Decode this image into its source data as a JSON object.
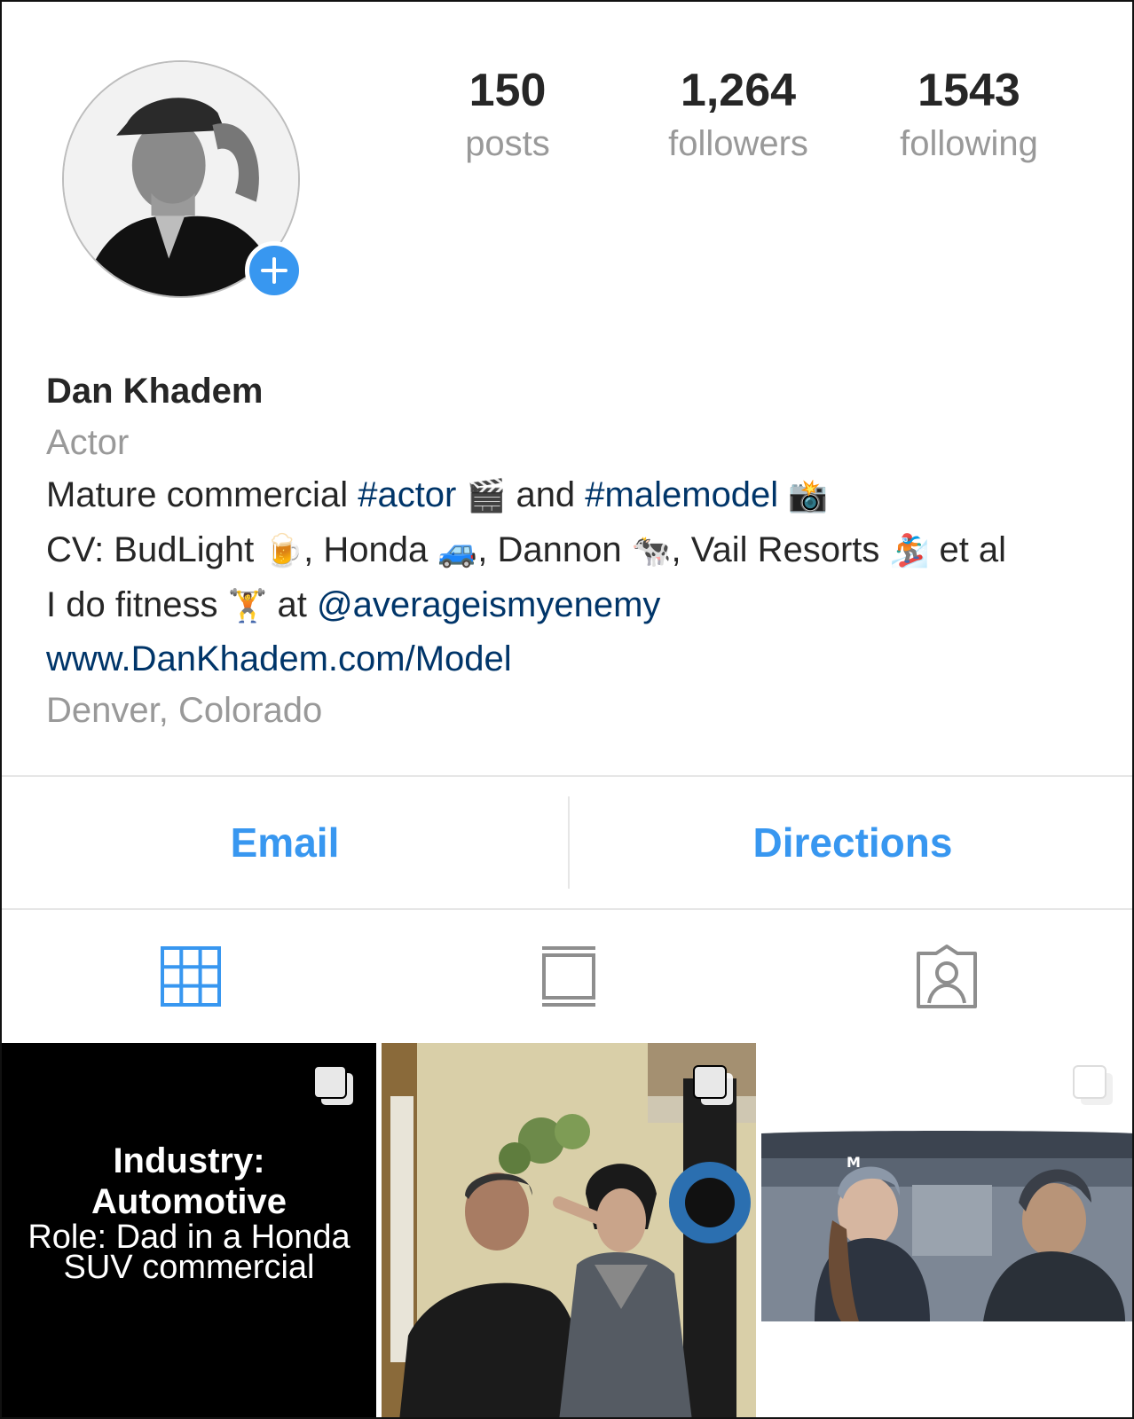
{
  "profile": {
    "stats": [
      {
        "count": "150",
        "label": "posts"
      },
      {
        "count": "1,264",
        "label": "followers"
      },
      {
        "count": "1543",
        "label": "following"
      }
    ],
    "name": "Dan Khadem",
    "category": "Actor",
    "bio": {
      "line1": {
        "a": "Mature commercial ",
        "tag1": "#actor",
        "e1": "🎬",
        "b": " and ",
        "tag2": "#malemodel",
        "e2": "📸"
      },
      "line2": {
        "a": "CV: BudLight ",
        "e1": "🍺",
        "b": ", Honda ",
        "e2": "🚙",
        "c": ", Dannon ",
        "e3": "🐄",
        "d": ", Vail Resorts ",
        "e4": "🏂",
        "e": " et al"
      },
      "line3": {
        "a": "I do fitness ",
        "e1": "🏋",
        "b": " at ",
        "mention": "@averageismyenemy"
      }
    },
    "website": "www.DanKhadem.com/Model",
    "location": "Denver, Colorado"
  },
  "actions": {
    "email": "Email",
    "directions": "Directions"
  },
  "tabs": [
    {
      "icon": "grid-icon",
      "active": true
    },
    {
      "icon": "feed-icon",
      "active": false
    },
    {
      "icon": "tagged-icon",
      "active": false
    }
  ],
  "posts": [
    {
      "line1": "Industry:",
      "line2": "Automotive",
      "line3": "Role: Dad in a Honda",
      "line4": "SUV commercial",
      "multi": true
    },
    {
      "multi": true
    },
    {
      "multi": true
    }
  ],
  "colors": {
    "accent": "#3897f0",
    "link": "#003569",
    "muted": "#999999",
    "text": "#262626"
  }
}
